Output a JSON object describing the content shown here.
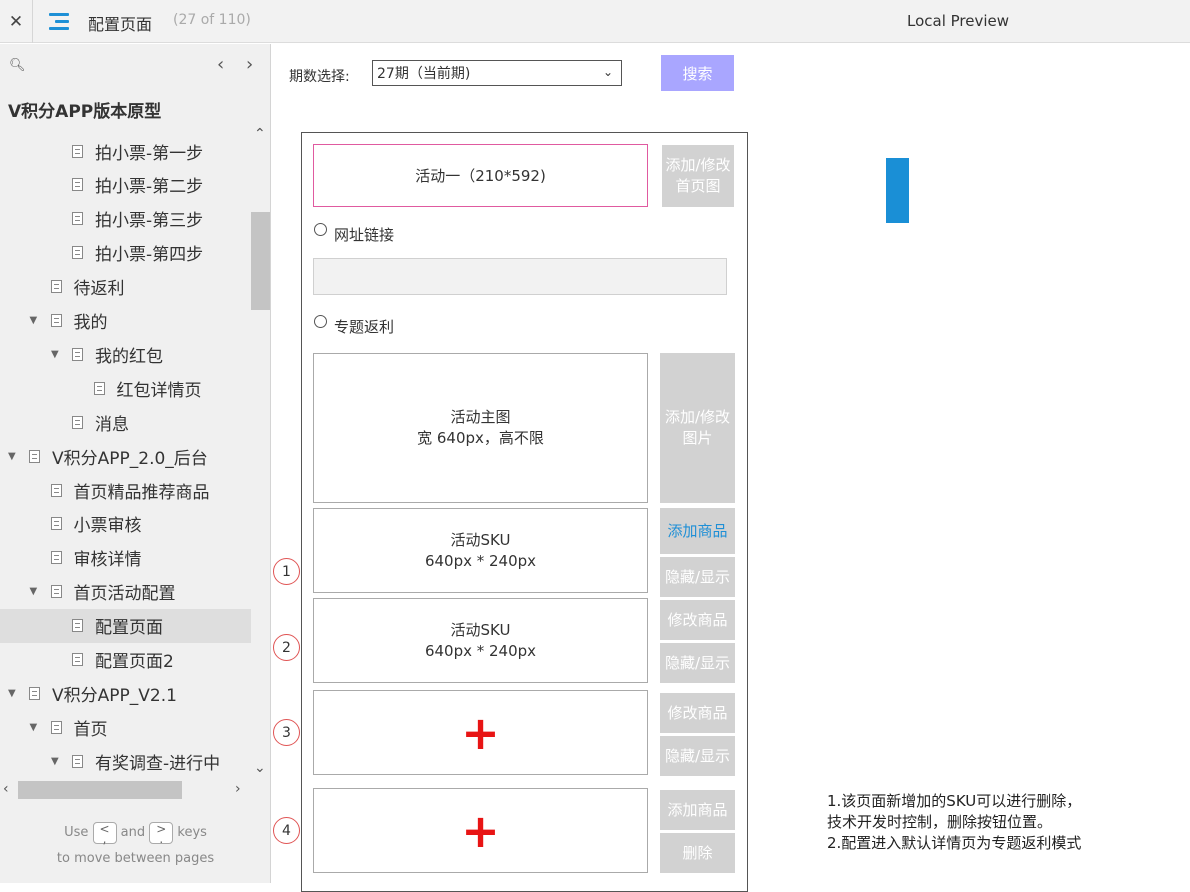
{
  "topbar": {
    "title": "配置页面",
    "page_count": "(27 of 110)",
    "preview": "Local Preview",
    "close_glyph": "✕"
  },
  "sidebar": {
    "project": "V积分APP版本原型",
    "tree": [
      {
        "label": "拍小票-第一步"
      },
      {
        "label": "拍小票-第二步"
      },
      {
        "label": "拍小票-第三步"
      },
      {
        "label": "拍小票-第四步"
      },
      {
        "label": "待返利"
      },
      {
        "label": "我的"
      },
      {
        "label": "我的红包"
      },
      {
        "label": "红包详情页"
      },
      {
        "label": "消息"
      },
      {
        "label": "V积分APP_2.0_后台"
      },
      {
        "label": "首页精品推荐商品"
      },
      {
        "label": "小票审核"
      },
      {
        "label": "审核详情"
      },
      {
        "label": "首页活动配置"
      },
      {
        "label": "配置页面"
      },
      {
        "label": "配置页面2"
      },
      {
        "label": "V积分APP_V2.1"
      },
      {
        "label": "首页"
      },
      {
        "label": "有奖调查-进行中"
      }
    ],
    "help": {
      "use": "Use",
      "key_prev": "<\n,",
      "and": "and",
      "key_next": ">\n.",
      "keys": "keys",
      "line2": "to move between pages"
    }
  },
  "main": {
    "period_label": "期数选择:",
    "period_value": "27期（当前期)",
    "search_label": "搜索",
    "activity_title": "活动一（210*592)",
    "add_home_image": "添加/修改首页图",
    "radio_url": "网址链接",
    "radio_topic": "专题返利",
    "main_image_title": "活动主图",
    "main_image_spec": "宽 640px，高不限",
    "add_image": "添加/修改图片",
    "sku_title": "活动SKU",
    "sku_spec": "640px * 240px",
    "add_product": "添加商品",
    "hide_show": "隐藏/显示",
    "edit_product": "修改商品",
    "delete": "删除",
    "plus": "+",
    "circles": [
      "1",
      "2",
      "3",
      "4"
    ],
    "notes": "1.该页面新增加的SKU可以进行删除，技术开发时控制，删除按钮位置。\n2.配置进入默认详情页为专题返利模式"
  },
  "colors": {
    "accent_blue": "#1e8fd6",
    "search_button": "#a9a6ff",
    "gray_button": "#d2d2d2",
    "plus_red": "#e81414",
    "activity_border": "#e05aa0"
  }
}
